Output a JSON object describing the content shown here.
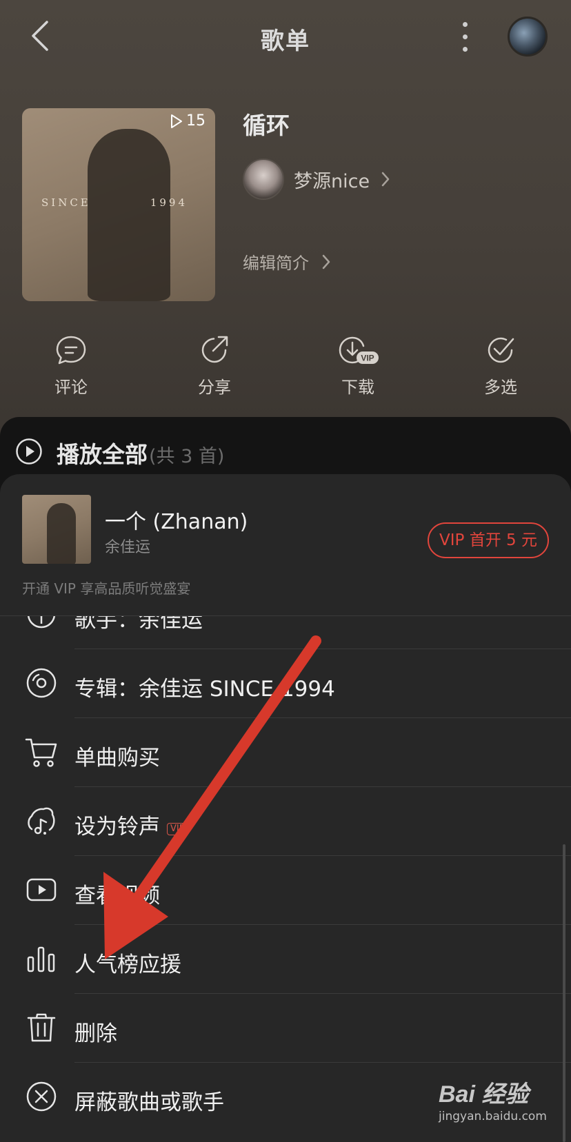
{
  "header": {
    "title": "歌单"
  },
  "playlist": {
    "name": "循环",
    "play_count": "15",
    "cover_text_left": "SINCE",
    "cover_text_right": "1994",
    "creator": "梦源nice",
    "edit_intro": "编辑简介"
  },
  "actions": [
    {
      "label": "评论",
      "icon": "comment-icon"
    },
    {
      "label": "分享",
      "icon": "share-icon"
    },
    {
      "label": "下载",
      "icon": "download-vip-icon",
      "badge": "VIP"
    },
    {
      "label": "多选",
      "icon": "multi-select-icon"
    }
  ],
  "play_all": {
    "label": "播放全部",
    "count": "(共 3 首)"
  },
  "sheet": {
    "song_title": "一个 (Zhanan)",
    "song_artist": "余佳运",
    "vip_button": "VIP 首开 5 元",
    "vip_tip": "开通 VIP 享高品质听觉盛宴",
    "menu": [
      {
        "label": "歌手：余佳运",
        "icon": "singer-icon"
      },
      {
        "label": "专辑：余佳运 SINCE 1994",
        "icon": "album-disc-icon"
      },
      {
        "label": "单曲购买",
        "icon": "cart-icon"
      },
      {
        "label": "设为铃声",
        "icon": "ringtone-icon",
        "tag": "VIP"
      },
      {
        "label": "查看视频",
        "icon": "video-icon"
      },
      {
        "label": "人气榜应援",
        "icon": "bar-chart-icon"
      },
      {
        "label": "删除",
        "icon": "trash-icon"
      },
      {
        "label": "屏蔽歌曲或歌手",
        "icon": "block-icon"
      }
    ]
  },
  "watermark": {
    "logo": "Bai 经验",
    "url": "jingyan.baidu.com"
  },
  "colors": {
    "accent": "#e2453c",
    "arrow": "#d7392b",
    "sheet_bg": "#272727",
    "header_bg": "#453f39"
  }
}
